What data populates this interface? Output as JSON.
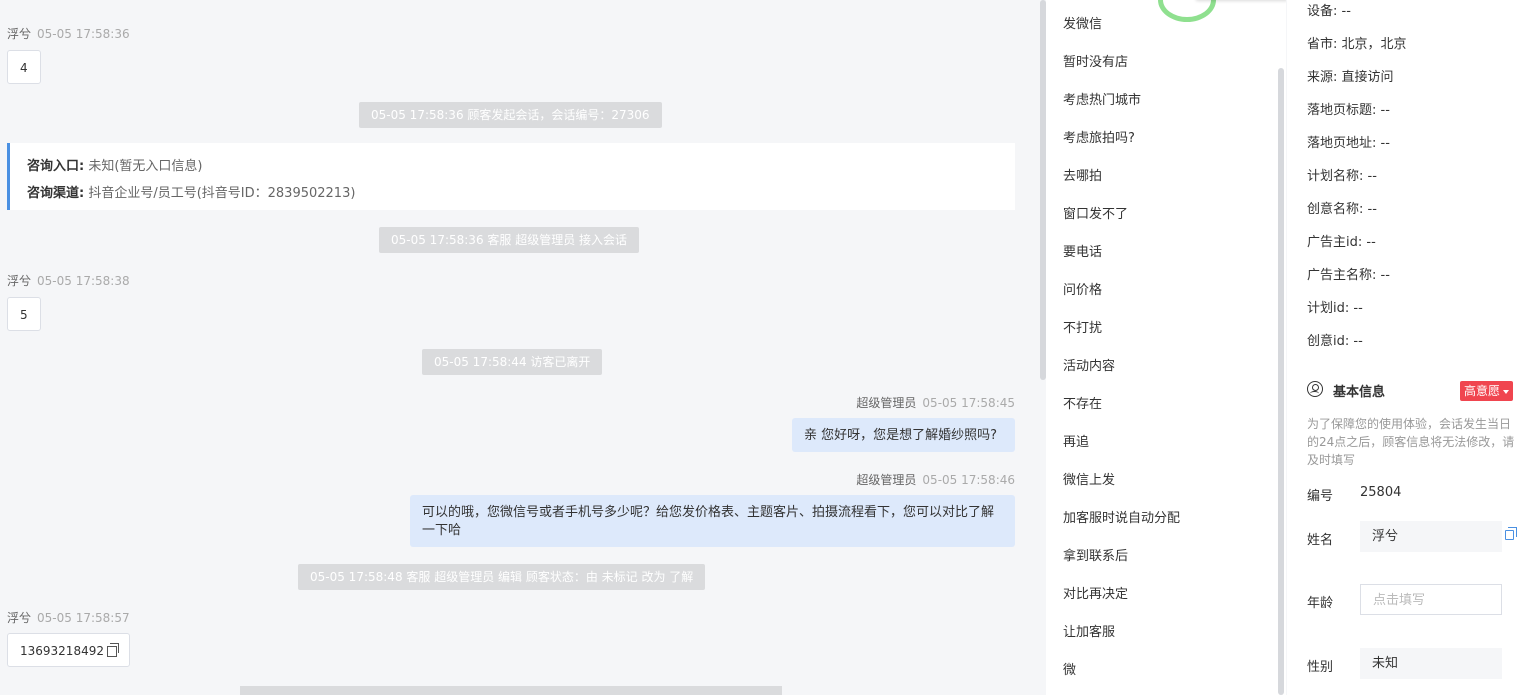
{
  "chat": {
    "messages": [
      {
        "sender": "浮兮",
        "time": "05-05 17:58:36",
        "text": "4"
      },
      {
        "sys": "05-05 17:58:36 顾客发起会话，会话编号：27306"
      },
      {
        "sys": "05-05 17:58:36 客服 超级管理员 接入会话"
      },
      {
        "sender": "浮兮",
        "time": "05-05 17:58:38",
        "text": "5"
      },
      {
        "sys": "05-05 17:58:44 访客已离开"
      },
      {
        "sender": "超级管理员",
        "time": "05-05 17:58:45",
        "text": "亲 您好呀，您是想了解婚纱照吗?"
      },
      {
        "sender": "超级管理员",
        "time": "05-05 17:58:46",
        "text": "可以的哦，您微信号或者手机号多少呢？给您发价格表、主题客片、拍摄流程看下，您可以对比了解一下哈"
      },
      {
        "sys": "05-05 17:58:48 客服 超级管理员 编辑 顾客状态：由 未标记 改为 了解"
      },
      {
        "sender": "浮兮",
        "time": "05-05 17:58:57",
        "text": "13693218492"
      }
    ],
    "consult": {
      "entry_label": "咨询入口:",
      "entry_value": "未知(暂无入口信息)",
      "channel_label": "咨询渠道:",
      "channel_value": "抖音企业号/员工号(抖音号ID：2839502213)"
    }
  },
  "quick_replies": [
    "发微信",
    "暂时没有店",
    "考虑热门城市",
    "考虑旅拍吗?",
    "去哪拍",
    "窗口发不了",
    "要电话",
    "问价格",
    "不打扰",
    "活动内容",
    "不存在",
    "再追",
    "微信上发",
    "加客服时说自动分配",
    "拿到联系后",
    "对比再决定",
    "让加客服",
    "微"
  ],
  "visitor_info": [
    {
      "label": "设备:",
      "value": "--"
    },
    {
      "label": "省市:",
      "value": "北京，北京"
    },
    {
      "label": "来源:",
      "value": "直接访问"
    },
    {
      "label": "落地页标题:",
      "value": "--"
    },
    {
      "label": "落地页地址:",
      "value": "--"
    },
    {
      "label": "计划名称:",
      "value": "--"
    },
    {
      "label": "创意名称:",
      "value": "--"
    },
    {
      "label": "广告主id:",
      "value": "--"
    },
    {
      "label": "广告主名称:",
      "value": "--"
    },
    {
      "label": "计划id:",
      "value": "--"
    },
    {
      "label": "创意id:",
      "value": "--"
    }
  ],
  "basic_info": {
    "title": "基本信息",
    "intent_badge": "高意愿",
    "notice": "为了保障您的使用体验，会话发生当日的24点之后，顾客信息将无法修改，请及时填写",
    "id_label": "编号",
    "id_value": "25804",
    "name_label": "姓名",
    "name_value": "浮兮",
    "age_label": "年龄",
    "age_placeholder": "点击填写",
    "gender_label": "性别",
    "gender_value": "未知"
  },
  "colors": {
    "accent": "#4a90e2",
    "badge": "#f0454f",
    "out_bubble": "#dde9fb"
  }
}
